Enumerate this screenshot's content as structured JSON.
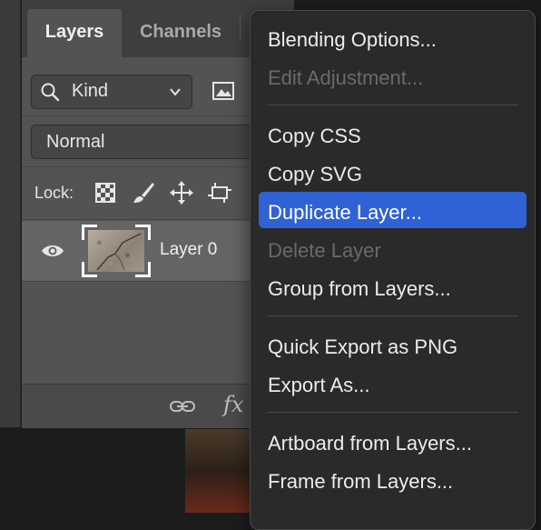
{
  "panel": {
    "tabs": [
      "Layers",
      "Channels"
    ],
    "filter": {
      "label": "Kind"
    },
    "blend_mode": "Normal",
    "lock_label": "Lock:",
    "layer": {
      "name": "Layer 0"
    },
    "bottom": {
      "fx_label": "fx"
    }
  },
  "menu": {
    "items": [
      {
        "label": "Blending Options...",
        "enabled": true
      },
      {
        "label": "Edit Adjustment...",
        "enabled": false
      },
      {
        "label": "Copy CSS",
        "enabled": true
      },
      {
        "label": "Copy SVG",
        "enabled": true
      },
      {
        "label": "Duplicate Layer...",
        "enabled": true,
        "highlighted": true
      },
      {
        "label": "Delete Layer",
        "enabled": false
      },
      {
        "label": "Group from Layers...",
        "enabled": true
      },
      {
        "label": "Quick Export as PNG",
        "enabled": true
      },
      {
        "label": "Export As...",
        "enabled": true
      },
      {
        "label": "Artboard from Layers...",
        "enabled": true
      },
      {
        "label": "Frame from Layers...",
        "enabled": true
      }
    ]
  },
  "colors": {
    "highlight": "#2f62d4",
    "menu_bg": "#2a2a2a",
    "panel_bg": "#535353"
  },
  "icons": [
    "search-icon",
    "chevron-down-icon",
    "image-filter-icon",
    "lock-transparent-icon",
    "lock-paint-icon",
    "lock-move-icon",
    "lock-artboard-icon",
    "eye-icon",
    "link-icon"
  ]
}
